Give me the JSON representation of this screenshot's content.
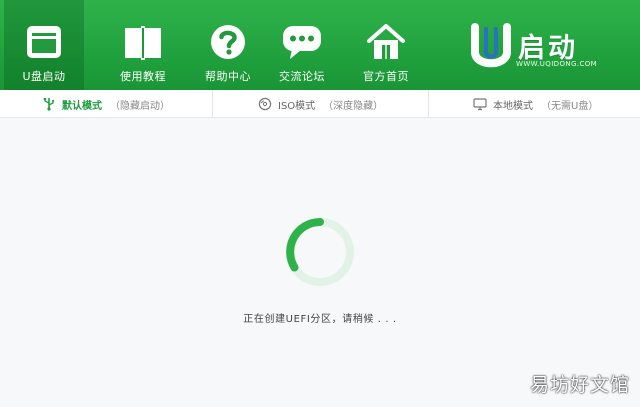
{
  "nav": {
    "items": [
      {
        "label": "U盘启动",
        "icon": "window-icon"
      },
      {
        "label": "使用教程",
        "icon": "book-icon"
      },
      {
        "label": "帮助中心",
        "icon": "help-icon"
      },
      {
        "label": "交流论坛",
        "icon": "chat-icon"
      },
      {
        "label": "官方首页",
        "icon": "home-icon"
      }
    ]
  },
  "logo": {
    "text": "启动",
    "url": "WWW.UQIDONG.COM"
  },
  "modes": [
    {
      "title": "默认模式",
      "sub": "（隐藏启动）",
      "icon": "usb-icon",
      "active": true
    },
    {
      "title": "ISO模式",
      "sub": "（深度隐藏）",
      "icon": "disc-icon",
      "active": false
    },
    {
      "title": "本地模式",
      "sub": "（无需U盘）",
      "icon": "monitor-icon",
      "active": false
    }
  ],
  "status": {
    "text": "正在创建UEFI分区，请稍候 . . ."
  },
  "watermark": {
    "text": "易坊好文馆"
  },
  "colors": {
    "primary": "#22a33f",
    "accent": "#1f9e3d",
    "spinner": "#2fb24a"
  }
}
